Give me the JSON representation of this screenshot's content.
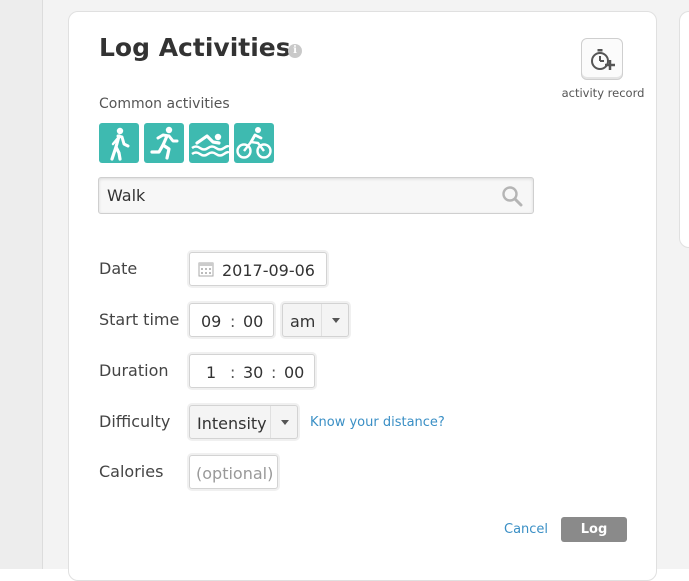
{
  "header": {
    "title": "Log Activities",
    "info_icon_glyph": "i",
    "activity_record_label": "activity record"
  },
  "common_activities": {
    "label": "Common activities",
    "accent_color": "#3ebab0",
    "icons": [
      "walk-icon",
      "run-icon",
      "swim-icon",
      "bike-icon"
    ]
  },
  "search": {
    "value": "Walk"
  },
  "form": {
    "date": {
      "label": "Date",
      "value": "2017-09-06"
    },
    "start_time": {
      "label": "Start time",
      "hour": "09",
      "separator": ":",
      "minute": "00",
      "ampm": "am"
    },
    "duration": {
      "label": "Duration",
      "hours": "1",
      "minutes": "30",
      "seconds": "00",
      "separator": ":"
    },
    "difficulty": {
      "label": "Difficulty",
      "value": "Intensity",
      "link": "Know your distance?"
    },
    "calories": {
      "label": "Calories",
      "placeholder": "(optional)"
    }
  },
  "actions": {
    "cancel_label": "Cancel",
    "log_label": "Log"
  }
}
